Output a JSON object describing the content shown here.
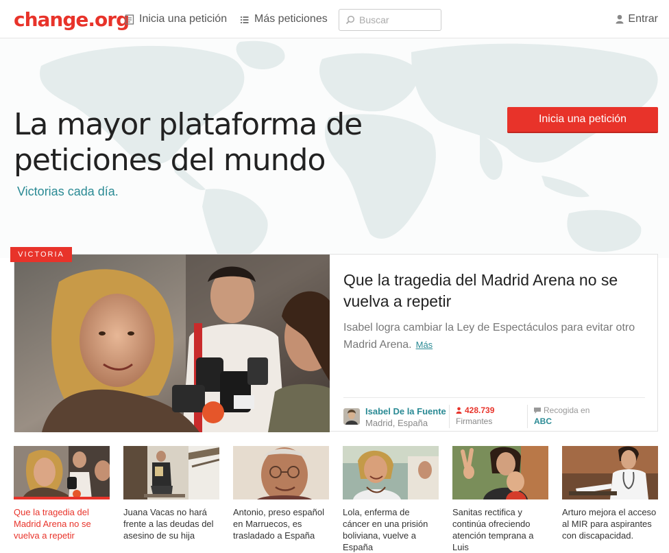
{
  "header": {
    "logo": "change.org",
    "nav_start": "Inicia una petición",
    "nav_more": "Más peticiones",
    "search_placeholder": "Buscar",
    "login": "Entrar"
  },
  "hero": {
    "title": "La mayor plataforma de peticiones del mundo",
    "subtitle": "Victorias cada día.",
    "cta": "Inicia una petición"
  },
  "feature": {
    "badge": "VICTORIA",
    "title": "Que la tragedia del Madrid Arena no se vuelva a repetir",
    "description": "Isabel logra cambiar la Ley de Espectáculos para evitar otro Madrid Arena.",
    "more": "Más",
    "author_name": "Isabel De la Fuente",
    "author_location": "Madrid, España",
    "signatures": "428.739",
    "signatures_label": "Firmantes",
    "press_label": "Recogida en",
    "press_name": "ABC"
  },
  "thumbnails": [
    {
      "caption": "Que la tragedia del Madrid Arena no se vuelva a repetir",
      "active": true
    },
    {
      "caption": "Juana Vacas no hará frente a las deudas del asesino de su hija",
      "active": false
    },
    {
      "caption": "Antonio, preso español en Marruecos, es trasladado a España",
      "active": false
    },
    {
      "caption": "Lola, enferma de cáncer en una prisión boliviana, vuelve a España",
      "active": false
    },
    {
      "caption": "Sanitas rectifica y continúa ofreciendo atención temprana a Luis",
      "active": false
    },
    {
      "caption": "Arturo mejora el acceso al MIR para aspirantes con discapacidad.",
      "active": false
    }
  ],
  "colors": {
    "brand": "#e8332a",
    "accent": "#2a8a94"
  }
}
